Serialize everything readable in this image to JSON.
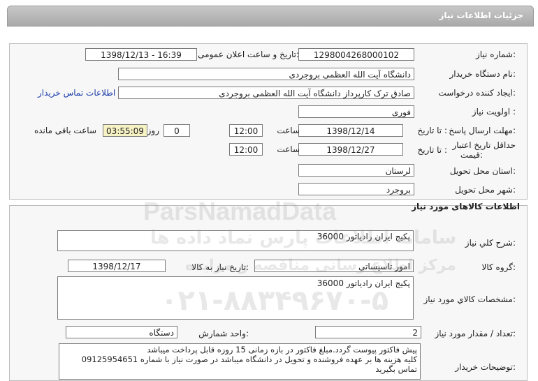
{
  "header": {
    "title": "جزئیات اطلاعات نیاز"
  },
  "info": {
    "need_number_label": "شماره نیاز:",
    "need_number": "1298004268000102",
    "announce_label": "تاریخ و ساعت اعلان عمومی:",
    "announce_value": "1398/12/13 - 16:39",
    "buyer_org_label": "نام دستگاه خریدار:",
    "buyer_org": "دانشگاه آیت الله العظمی بروجردی",
    "creator_label": "ایجاد کننده درخواست:",
    "creator": "صادق ترک کارپرداز دانشگاه آیت الله العظمی بروجردی",
    "contact_link": "اطلاعات تماس خریدار",
    "priority_label": "اولویت نیاز :",
    "priority": "فوری",
    "deadline_label": "مهلت ارسال پاسخ:",
    "to_date_label": "تا تاریخ :",
    "deadline_date": "1398/12/14",
    "time_label": "ساعت",
    "deadline_time": "12:00",
    "days_value": "0",
    "days_label": "روز و",
    "remaining_time": "03:55:09",
    "remaining_label": "ساعت باقی مانده",
    "validity_label_1": "حداقل تاریخ اعتبار",
    "validity_label_2": "قیمت:",
    "validity_to_label": "تا تاریخ :",
    "validity_date": "1398/12/27",
    "validity_time_label": "ساعت",
    "validity_time": "12:00",
    "province_label": "استان محل تحویل:",
    "province": "لرستان",
    "city_label": "شهر محل تحویل:",
    "city": "بروجرد"
  },
  "goods": {
    "section_title": "اطلاعات کالاهای مورد نیاز",
    "summary_label": "شرح کلي نياز:",
    "summary": "پکیج ایران رادیاتور 36000",
    "group_label": "گروه کالا:",
    "group": "امور تاسیساتی",
    "need_date_label": "تاریخ نیاز به کالا:",
    "need_date": "1398/12/17",
    "spec_label": "مشخصات کالاي مورد نياز:",
    "spec": "پکیج ایران رادیاتور 36000",
    "qty_label": "تعداد / مقدار مورد نیاز:",
    "qty": "2",
    "unit_label": "واحد شمارش:",
    "unit": "دستگاه",
    "notes_label": "توضیحات خریدار:",
    "notes_1": "پیش فاکتور پیوست گردد.مبلغ فاکتور در بازه زمانی 15 روزه قابل پرداخت میباشد",
    "notes_2": "کلیه هزینه ها بر عهده فروشنده و تحویل در دانشگاه میباشد در صورت نیاز با شماره 09125954651",
    "notes_3": "تماس بگیرید"
  },
  "watermark": {
    "brand": "ParsNamadData",
    "line1": "مرکز اطلاع رسانی مناقصه و مزایده",
    "line2": "سامانه اطلاعات پارس نماد داده ها",
    "phone": "۰۲۱-۸۸۳۴۹۶۷۰-۵"
  }
}
